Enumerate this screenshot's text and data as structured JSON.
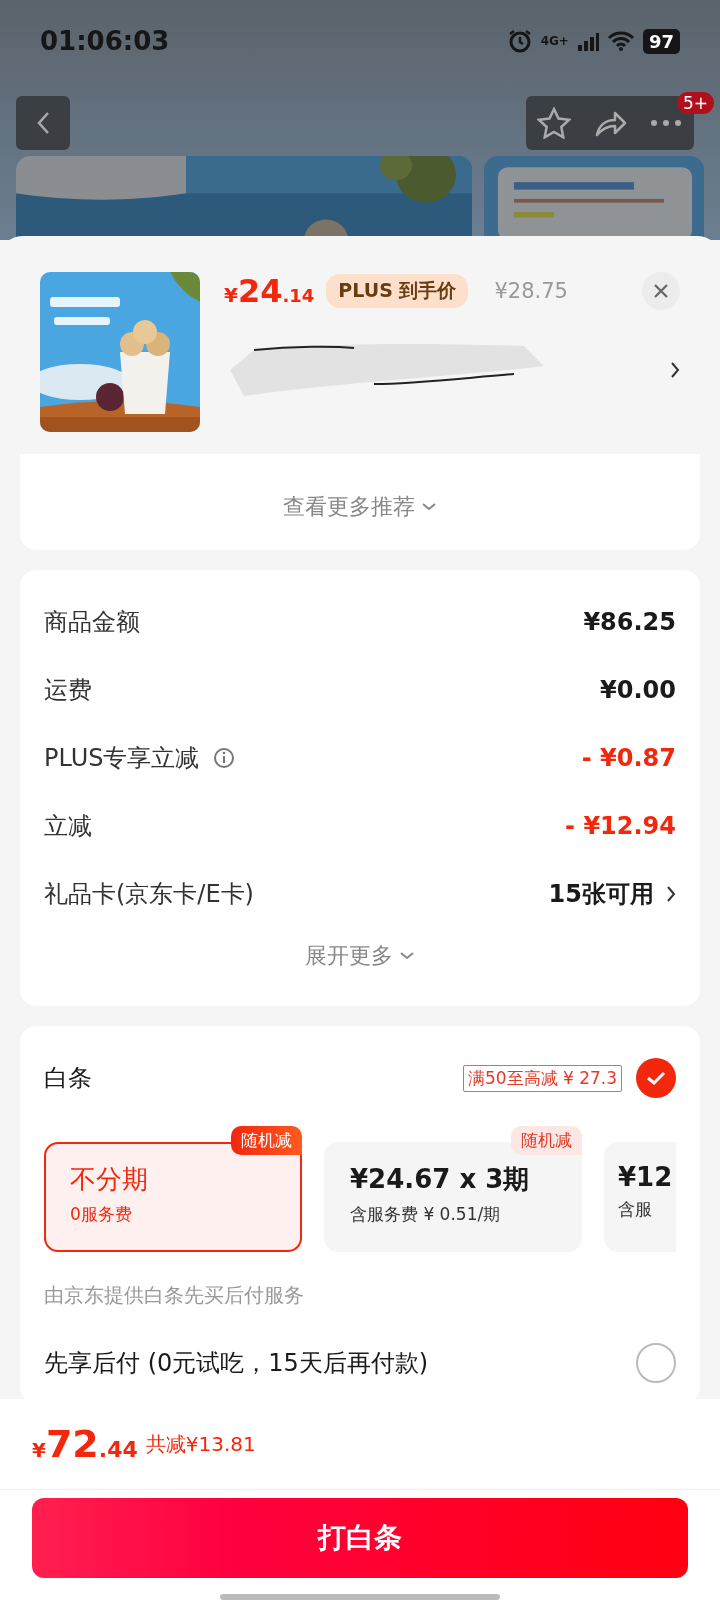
{
  "status_bar": {
    "time": "01:06:03",
    "network": "4G+",
    "battery": "97"
  },
  "nav": {
    "badge": "5+"
  },
  "product": {
    "currency": "¥",
    "price_int": "24",
    "price_dec": ".14",
    "plus_tag": "PLUS 到手价",
    "original_price": "¥28.75"
  },
  "recommend": {
    "label": "查看更多推荐"
  },
  "summary": {
    "rows": [
      {
        "kind": "plain",
        "label": "商品金额",
        "value": "¥86.25",
        "info": false
      },
      {
        "kind": "plain",
        "label": "运费",
        "value": "¥0.00",
        "info": false
      },
      {
        "kind": "discount",
        "label": "PLUS专享立减",
        "value": "- ¥0.87",
        "info": true
      },
      {
        "kind": "discount",
        "label": "立减",
        "value": "- ¥12.94",
        "info": false
      },
      {
        "kind": "link",
        "label": "礼品卡(京东卡/E卡)",
        "value": "15张可用",
        "info": false
      }
    ],
    "expand": "展开更多"
  },
  "payment": {
    "title": "白条",
    "promo": "满50至高减 ¥ 27.3",
    "checked": true,
    "plans": [
      {
        "title": "不分期",
        "subtitle": "0服务费",
        "tag": "随机减",
        "selected": true
      },
      {
        "title": "¥24.67 x 3期",
        "subtitle": "含服务费 ¥ 0.51/期",
        "tag": "随机减",
        "selected": false
      },
      {
        "title": "¥12",
        "subtitle": "含服",
        "selected": false
      }
    ],
    "note": "由京东提供白条先买后付服务",
    "pay_later": {
      "label": "先享后付 (0元试吃，15天后再付款)",
      "checked": false
    }
  },
  "footer": {
    "currency": "¥",
    "total_int": "72",
    "total_dec": ".44",
    "saved": "共减¥13.81",
    "button": "打白条"
  }
}
